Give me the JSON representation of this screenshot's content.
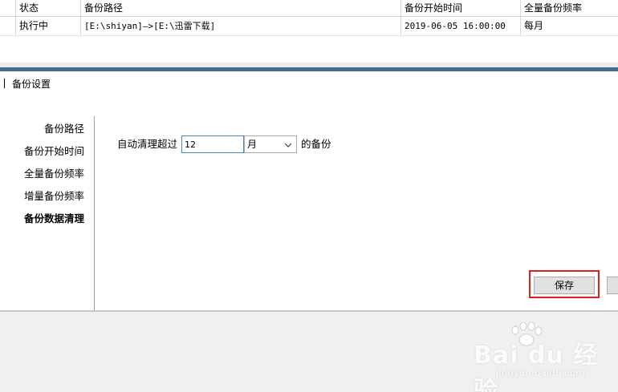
{
  "table": {
    "headers": [
      "状态",
      "备份路径",
      "备份开始时间",
      "全量备份频率"
    ],
    "rows": [
      {
        "status": "执行中",
        "path": "[E:\\shiyan]—>[E:\\迅雷下载]",
        "start_time": "2019-06-05 16:00:00",
        "frequency": "每月"
      }
    ]
  },
  "panel": {
    "title": "备份设置",
    "nav": [
      {
        "label": "备份路径",
        "active": false
      },
      {
        "label": "备份开始时间",
        "active": false
      },
      {
        "label": "全量备份频率",
        "active": false
      },
      {
        "label": "增量备份频率",
        "active": false
      },
      {
        "label": "备份数据清理",
        "active": true
      }
    ],
    "cleanup": {
      "prefix_label": "自动清理超过",
      "value": "12",
      "unit_selected": "月",
      "suffix_label": "的备份"
    },
    "save_label": "保存"
  },
  "watermark": {
    "logo": "Bai du 经验",
    "sub": "jingyan.baidu.com"
  },
  "colors": {
    "accent_bar": "#4a6a93",
    "highlight": "#e02020",
    "input_border": "#4a86c8"
  }
}
